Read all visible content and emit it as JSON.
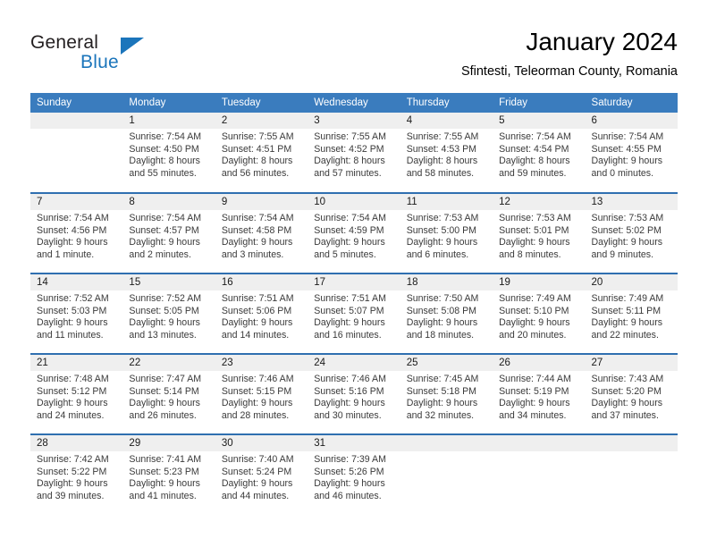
{
  "brand": {
    "word_general": "General",
    "word_blue": "Blue",
    "accent_color": "#1b75bb"
  },
  "header": {
    "title": "January 2024",
    "subtitle": "Sfintesti, Teleorman County, Romania"
  },
  "calendar": {
    "header_bg": "#3a7cbe",
    "daynum_bg": "#efefef",
    "row_divider_color": "#2f6fb0",
    "weekday_headers": [
      "Sunday",
      "Monday",
      "Tuesday",
      "Wednesday",
      "Thursday",
      "Friday",
      "Saturday"
    ],
    "labels": {
      "sunrise": "Sunrise:",
      "sunset": "Sunset:",
      "daylight": "Daylight:"
    },
    "weeks": [
      [
        {
          "day": "",
          "empty": true
        },
        {
          "day": "1",
          "sunrise": "Sunrise: 7:54 AM",
          "sunset": "Sunset: 4:50 PM",
          "daylight_line1": "Daylight: 8 hours",
          "daylight_line2": "and 55 minutes."
        },
        {
          "day": "2",
          "sunrise": "Sunrise: 7:55 AM",
          "sunset": "Sunset: 4:51 PM",
          "daylight_line1": "Daylight: 8 hours",
          "daylight_line2": "and 56 minutes."
        },
        {
          "day": "3",
          "sunrise": "Sunrise: 7:55 AM",
          "sunset": "Sunset: 4:52 PM",
          "daylight_line1": "Daylight: 8 hours",
          "daylight_line2": "and 57 minutes."
        },
        {
          "day": "4",
          "sunrise": "Sunrise: 7:55 AM",
          "sunset": "Sunset: 4:53 PM",
          "daylight_line1": "Daylight: 8 hours",
          "daylight_line2": "and 58 minutes."
        },
        {
          "day": "5",
          "sunrise": "Sunrise: 7:54 AM",
          "sunset": "Sunset: 4:54 PM",
          "daylight_line1": "Daylight: 8 hours",
          "daylight_line2": "and 59 minutes."
        },
        {
          "day": "6",
          "sunrise": "Sunrise: 7:54 AM",
          "sunset": "Sunset: 4:55 PM",
          "daylight_line1": "Daylight: 9 hours",
          "daylight_line2": "and 0 minutes."
        }
      ],
      [
        {
          "day": "7",
          "sunrise": "Sunrise: 7:54 AM",
          "sunset": "Sunset: 4:56 PM",
          "daylight_line1": "Daylight: 9 hours",
          "daylight_line2": "and 1 minute."
        },
        {
          "day": "8",
          "sunrise": "Sunrise: 7:54 AM",
          "sunset": "Sunset: 4:57 PM",
          "daylight_line1": "Daylight: 9 hours",
          "daylight_line2": "and 2 minutes."
        },
        {
          "day": "9",
          "sunrise": "Sunrise: 7:54 AM",
          "sunset": "Sunset: 4:58 PM",
          "daylight_line1": "Daylight: 9 hours",
          "daylight_line2": "and 3 minutes."
        },
        {
          "day": "10",
          "sunrise": "Sunrise: 7:54 AM",
          "sunset": "Sunset: 4:59 PM",
          "daylight_line1": "Daylight: 9 hours",
          "daylight_line2": "and 5 minutes."
        },
        {
          "day": "11",
          "sunrise": "Sunrise: 7:53 AM",
          "sunset": "Sunset: 5:00 PM",
          "daylight_line1": "Daylight: 9 hours",
          "daylight_line2": "and 6 minutes."
        },
        {
          "day": "12",
          "sunrise": "Sunrise: 7:53 AM",
          "sunset": "Sunset: 5:01 PM",
          "daylight_line1": "Daylight: 9 hours",
          "daylight_line2": "and 8 minutes."
        },
        {
          "day": "13",
          "sunrise": "Sunrise: 7:53 AM",
          "sunset": "Sunset: 5:02 PM",
          "daylight_line1": "Daylight: 9 hours",
          "daylight_line2": "and 9 minutes."
        }
      ],
      [
        {
          "day": "14",
          "sunrise": "Sunrise: 7:52 AM",
          "sunset": "Sunset: 5:03 PM",
          "daylight_line1": "Daylight: 9 hours",
          "daylight_line2": "and 11 minutes."
        },
        {
          "day": "15",
          "sunrise": "Sunrise: 7:52 AM",
          "sunset": "Sunset: 5:05 PM",
          "daylight_line1": "Daylight: 9 hours",
          "daylight_line2": "and 13 minutes."
        },
        {
          "day": "16",
          "sunrise": "Sunrise: 7:51 AM",
          "sunset": "Sunset: 5:06 PM",
          "daylight_line1": "Daylight: 9 hours",
          "daylight_line2": "and 14 minutes."
        },
        {
          "day": "17",
          "sunrise": "Sunrise: 7:51 AM",
          "sunset": "Sunset: 5:07 PM",
          "daylight_line1": "Daylight: 9 hours",
          "daylight_line2": "and 16 minutes."
        },
        {
          "day": "18",
          "sunrise": "Sunrise: 7:50 AM",
          "sunset": "Sunset: 5:08 PM",
          "daylight_line1": "Daylight: 9 hours",
          "daylight_line2": "and 18 minutes."
        },
        {
          "day": "19",
          "sunrise": "Sunrise: 7:49 AM",
          "sunset": "Sunset: 5:10 PM",
          "daylight_line1": "Daylight: 9 hours",
          "daylight_line2": "and 20 minutes."
        },
        {
          "day": "20",
          "sunrise": "Sunrise: 7:49 AM",
          "sunset": "Sunset: 5:11 PM",
          "daylight_line1": "Daylight: 9 hours",
          "daylight_line2": "and 22 minutes."
        }
      ],
      [
        {
          "day": "21",
          "sunrise": "Sunrise: 7:48 AM",
          "sunset": "Sunset: 5:12 PM",
          "daylight_line1": "Daylight: 9 hours",
          "daylight_line2": "and 24 minutes."
        },
        {
          "day": "22",
          "sunrise": "Sunrise: 7:47 AM",
          "sunset": "Sunset: 5:14 PM",
          "daylight_line1": "Daylight: 9 hours",
          "daylight_line2": "and 26 minutes."
        },
        {
          "day": "23",
          "sunrise": "Sunrise: 7:46 AM",
          "sunset": "Sunset: 5:15 PM",
          "daylight_line1": "Daylight: 9 hours",
          "daylight_line2": "and 28 minutes."
        },
        {
          "day": "24",
          "sunrise": "Sunrise: 7:46 AM",
          "sunset": "Sunset: 5:16 PM",
          "daylight_line1": "Daylight: 9 hours",
          "daylight_line2": "and 30 minutes."
        },
        {
          "day": "25",
          "sunrise": "Sunrise: 7:45 AM",
          "sunset": "Sunset: 5:18 PM",
          "daylight_line1": "Daylight: 9 hours",
          "daylight_line2": "and 32 minutes."
        },
        {
          "day": "26",
          "sunrise": "Sunrise: 7:44 AM",
          "sunset": "Sunset: 5:19 PM",
          "daylight_line1": "Daylight: 9 hours",
          "daylight_line2": "and 34 minutes."
        },
        {
          "day": "27",
          "sunrise": "Sunrise: 7:43 AM",
          "sunset": "Sunset: 5:20 PM",
          "daylight_line1": "Daylight: 9 hours",
          "daylight_line2": "and 37 minutes."
        }
      ],
      [
        {
          "day": "28",
          "sunrise": "Sunrise: 7:42 AM",
          "sunset": "Sunset: 5:22 PM",
          "daylight_line1": "Daylight: 9 hours",
          "daylight_line2": "and 39 minutes."
        },
        {
          "day": "29",
          "sunrise": "Sunrise: 7:41 AM",
          "sunset": "Sunset: 5:23 PM",
          "daylight_line1": "Daylight: 9 hours",
          "daylight_line2": "and 41 minutes."
        },
        {
          "day": "30",
          "sunrise": "Sunrise: 7:40 AM",
          "sunset": "Sunset: 5:24 PM",
          "daylight_line1": "Daylight: 9 hours",
          "daylight_line2": "and 44 minutes."
        },
        {
          "day": "31",
          "sunrise": "Sunrise: 7:39 AM",
          "sunset": "Sunset: 5:26 PM",
          "daylight_line1": "Daylight: 9 hours",
          "daylight_line2": "and 46 minutes."
        },
        {
          "day": "",
          "empty": true
        },
        {
          "day": "",
          "empty": true
        },
        {
          "day": "",
          "empty": true
        }
      ]
    ]
  }
}
